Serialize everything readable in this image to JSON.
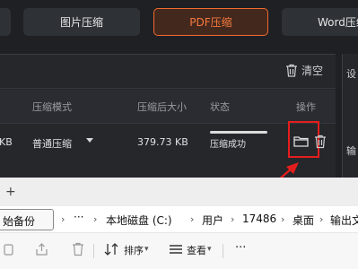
{
  "app": {
    "tabs": [
      {
        "label": ""
      },
      {
        "label": "图片压缩"
      },
      {
        "label": "PDF压缩"
      },
      {
        "label": "Word压缩"
      }
    ],
    "clear_label": "清空",
    "table": {
      "headers": [
        "压缩模式",
        "压缩后大小",
        "状态",
        "操作"
      ],
      "row": {
        "size_fragment": "KB",
        "mode": "普通压缩",
        "compressed_size": "379.73 KB",
        "status": "压缩成功",
        "progress": 1.0
      }
    },
    "side": {
      "top": "设",
      "bottom": "输"
    },
    "colors": {
      "accent": "#f26a2e",
      "highlight": "#e51d1d",
      "background": "#1e2024"
    }
  },
  "explorer": {
    "tab_close": "×",
    "tab_add": "+",
    "breadcrumb": {
      "first": "始备份",
      "more": "···",
      "items": [
        "本地磁盘 (C:)",
        "用户",
        "17486",
        "桌面",
        "输出文件"
      ]
    },
    "toolbar": {
      "sort_label": "排序",
      "view_label": "查看",
      "more_label": "···"
    }
  }
}
